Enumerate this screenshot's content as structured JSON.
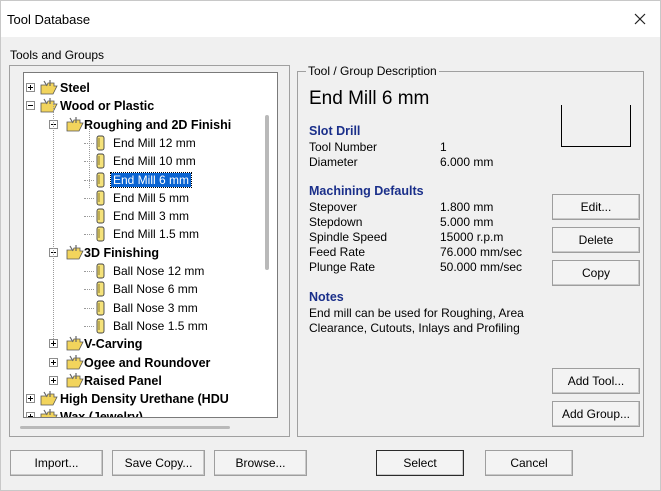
{
  "window": {
    "title": "Tool Database",
    "close_icon": "close-icon"
  },
  "tools_group_label": "Tools and Groups",
  "tree": [
    {
      "label": "Steel",
      "type": "folder",
      "level": 1,
      "expander": "plus",
      "bold": true
    },
    {
      "label": "Wood or Plastic",
      "type": "folder",
      "level": 1,
      "expander": "minus",
      "bold": true
    },
    {
      "label": "Roughing and 2D Finishi",
      "type": "folder",
      "level": 2,
      "expander": "minus",
      "bold": true
    },
    {
      "label": "End Mill 12 mm",
      "type": "tool",
      "level": 3
    },
    {
      "label": "End Mill 10 mm",
      "type": "tool",
      "level": 3
    },
    {
      "label": "End Mill 6 mm",
      "type": "tool",
      "level": 3,
      "selected": true
    },
    {
      "label": "End Mill 5 mm",
      "type": "tool",
      "level": 3
    },
    {
      "label": "End Mill 3 mm",
      "type": "tool",
      "level": 3
    },
    {
      "label": "End Mill 1.5 mm",
      "type": "tool",
      "level": 3
    },
    {
      "label": "3D Finishing",
      "type": "folder",
      "level": 2,
      "expander": "minus",
      "bold": true
    },
    {
      "label": "Ball Nose 12 mm",
      "type": "tool",
      "level": 3
    },
    {
      "label": "Ball Nose 6 mm",
      "type": "tool",
      "level": 3
    },
    {
      "label": "Ball Nose 3 mm",
      "type": "tool",
      "level": 3
    },
    {
      "label": "Ball Nose 1.5 mm",
      "type": "tool",
      "level": 3
    },
    {
      "label": "V-Carving",
      "type": "folder",
      "level": 2,
      "expander": "plus",
      "bold": true
    },
    {
      "label": "Ogee and Roundover",
      "type": "folder",
      "level": 2,
      "expander": "plus",
      "bold": true
    },
    {
      "label": "Raised Panel",
      "type": "folder",
      "level": 2,
      "expander": "plus",
      "bold": true
    },
    {
      "label": "High Density Urethane (HDU",
      "type": "folder",
      "level": 1,
      "expander": "plus",
      "bold": true
    },
    {
      "label": "Wax (Jewelry)",
      "type": "folder",
      "level": 1,
      "expander": "plus",
      "bold": true
    }
  ],
  "description": {
    "legend": "Tool / Group Description",
    "tool_name": "End Mill 6 mm",
    "tool_type": "Slot Drill",
    "tool_number_label": "Tool Number",
    "tool_number": "1",
    "diameter_label": "Diameter",
    "diameter": "6.000 mm",
    "machining_heading": "Machining Defaults",
    "stepover_label": "Stepover",
    "stepover": "1.800 mm",
    "stepdown_label": "Stepdown",
    "stepdown": "5.000 mm",
    "spindle_label": "Spindle Speed",
    "spindle": "15000 r.p.m",
    "feed_label": "Feed Rate",
    "feed": "76.000 mm/sec",
    "plunge_label": "Plunge Rate",
    "plunge": "50.000 mm/sec",
    "notes_heading": "Notes",
    "notes": "End mill can be used for Roughing, Area Clearance, Cutouts, Inlays and Profiling"
  },
  "buttons": {
    "edit": "Edit...",
    "delete": "Delete",
    "copy": "Copy",
    "add_tool": "Add Tool...",
    "add_group": "Add Group...",
    "import": "Import...",
    "save_copy": "Save Copy...",
    "browse": "Browse...",
    "select": "Select",
    "cancel": "Cancel"
  },
  "colors": {
    "heading_blue": "#1a2f8a",
    "selection": "#0a64d2",
    "folder_yellow": "#f2d45c",
    "tool_yellow": "#f5e27a"
  }
}
